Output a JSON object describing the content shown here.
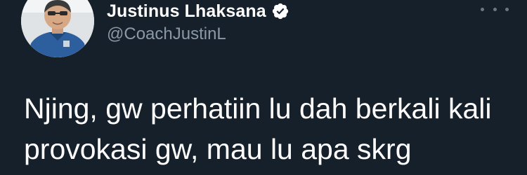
{
  "author": {
    "name": "Justinus Lhaksana",
    "handle": "@CoachJustinL",
    "verified_icon": "verified-badge-icon"
  },
  "more_icon": "more-horizontal-icon",
  "tweet": {
    "lines": [
      "Njing, gw perhatiin lu dah berkali kali",
      "provokasi gw, mau lu apa skrg"
    ]
  },
  "colors": {
    "background": "#15202b",
    "text": "#ffffff",
    "handle": "#8b98a5"
  }
}
